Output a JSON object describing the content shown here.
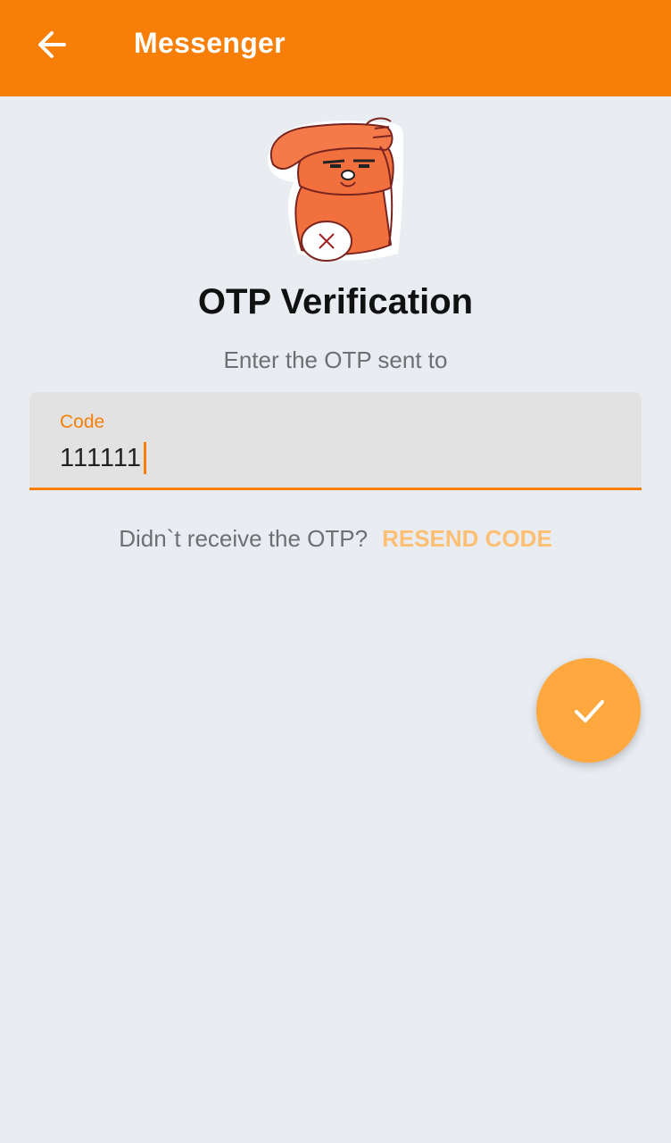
{
  "appbar": {
    "title": "Messenger",
    "back_icon": "arrow-left-icon"
  },
  "sticker": {
    "icon": "salute-cat-sticker"
  },
  "content": {
    "title": "OTP Verification",
    "subtitle": "Enter the OTP sent to"
  },
  "code_field": {
    "label": "Code",
    "value": "111111"
  },
  "resend": {
    "question": "Didn`t receive the OTP?",
    "link": "RESEND CODE"
  },
  "fab": {
    "icon": "check-icon"
  },
  "colors": {
    "primary": "#f77f08",
    "fab": "#ffa840",
    "link": "#fcbf74",
    "background": "#e9edf1"
  }
}
